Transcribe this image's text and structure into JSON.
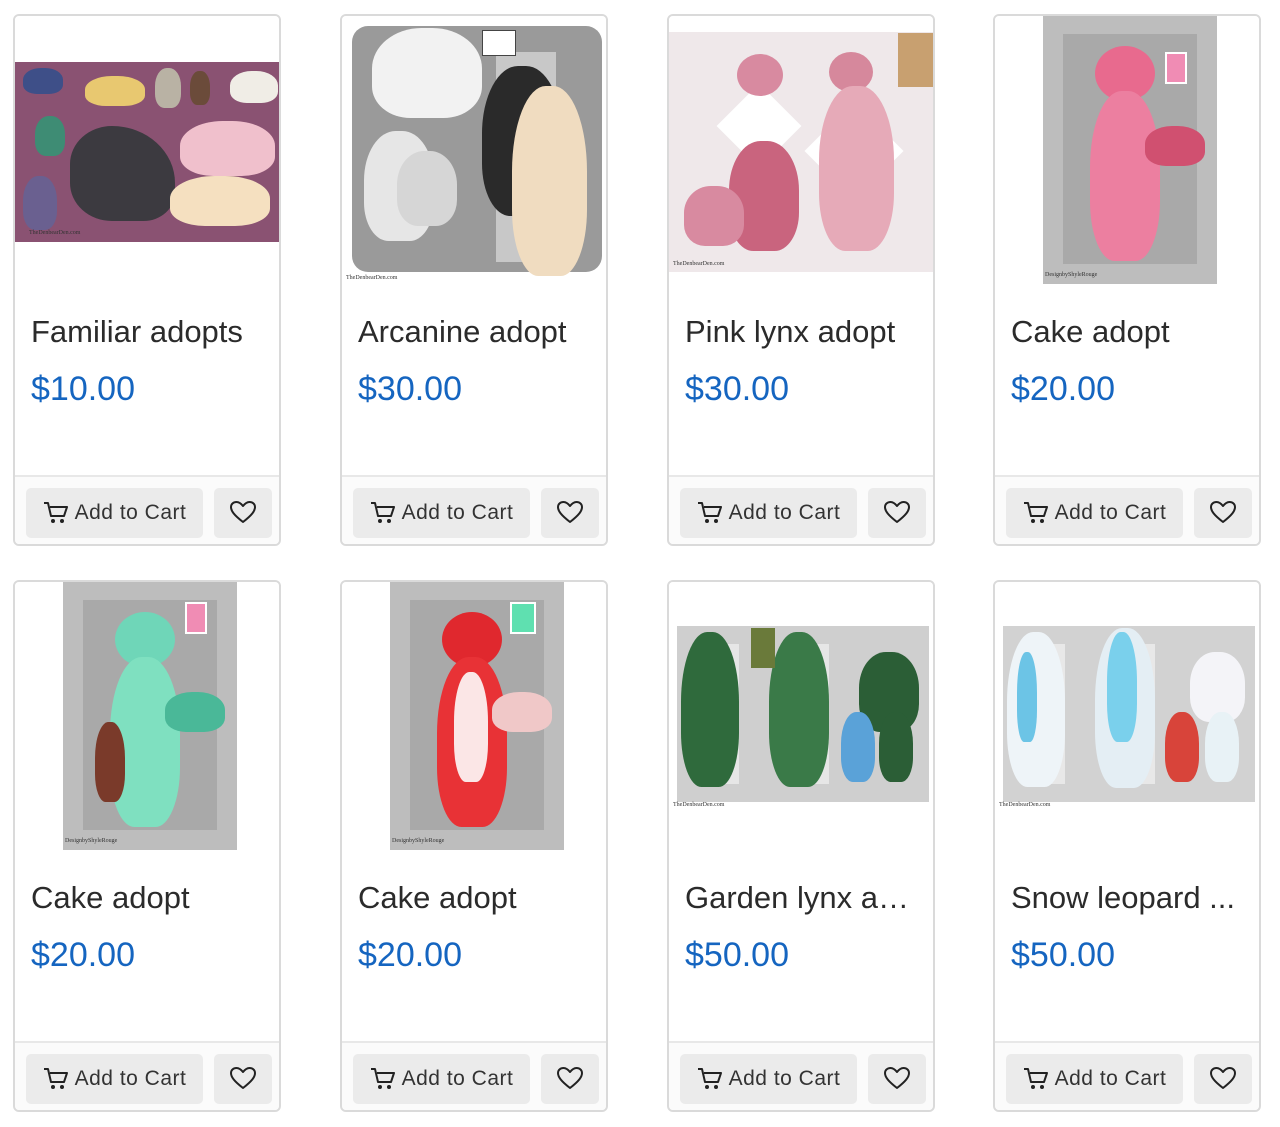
{
  "products": [
    {
      "title": "Familiar adopts",
      "price": "$10.00",
      "image_alt": "Familiar adopts sheet"
    },
    {
      "title": "Arcanine adopt",
      "price": "$30.00",
      "image_alt": "Arcanine adopt reference"
    },
    {
      "title": "Pink lynx adopt",
      "price": "$30.00",
      "image_alt": "Pink lynx adopt reference"
    },
    {
      "title": "Cake adopt",
      "price": "$20.00",
      "image_alt": "Pink cake adopt reference"
    },
    {
      "title": "Cake adopt",
      "price": "$20.00",
      "image_alt": "Mint cake adopt reference"
    },
    {
      "title": "Cake adopt",
      "price": "$20.00",
      "image_alt": "Red cake adopt reference"
    },
    {
      "title": "Garden lynx ad...",
      "price": "$50.00",
      "image_alt": "Garden lynx adopt reference"
    },
    {
      "title": "Snow leopard ...",
      "price": "$50.00",
      "image_alt": "Snow leopard adopt reference"
    }
  ],
  "actions": {
    "add_to_cart_label": "Add to Cart",
    "cart_icon": "cart-icon",
    "wishlist_icon": "heart-icon"
  },
  "colors": {
    "price": "#1565c0",
    "title": "#2b2b2b",
    "button_bg": "#ebebeb",
    "card_border": "#dadada"
  }
}
